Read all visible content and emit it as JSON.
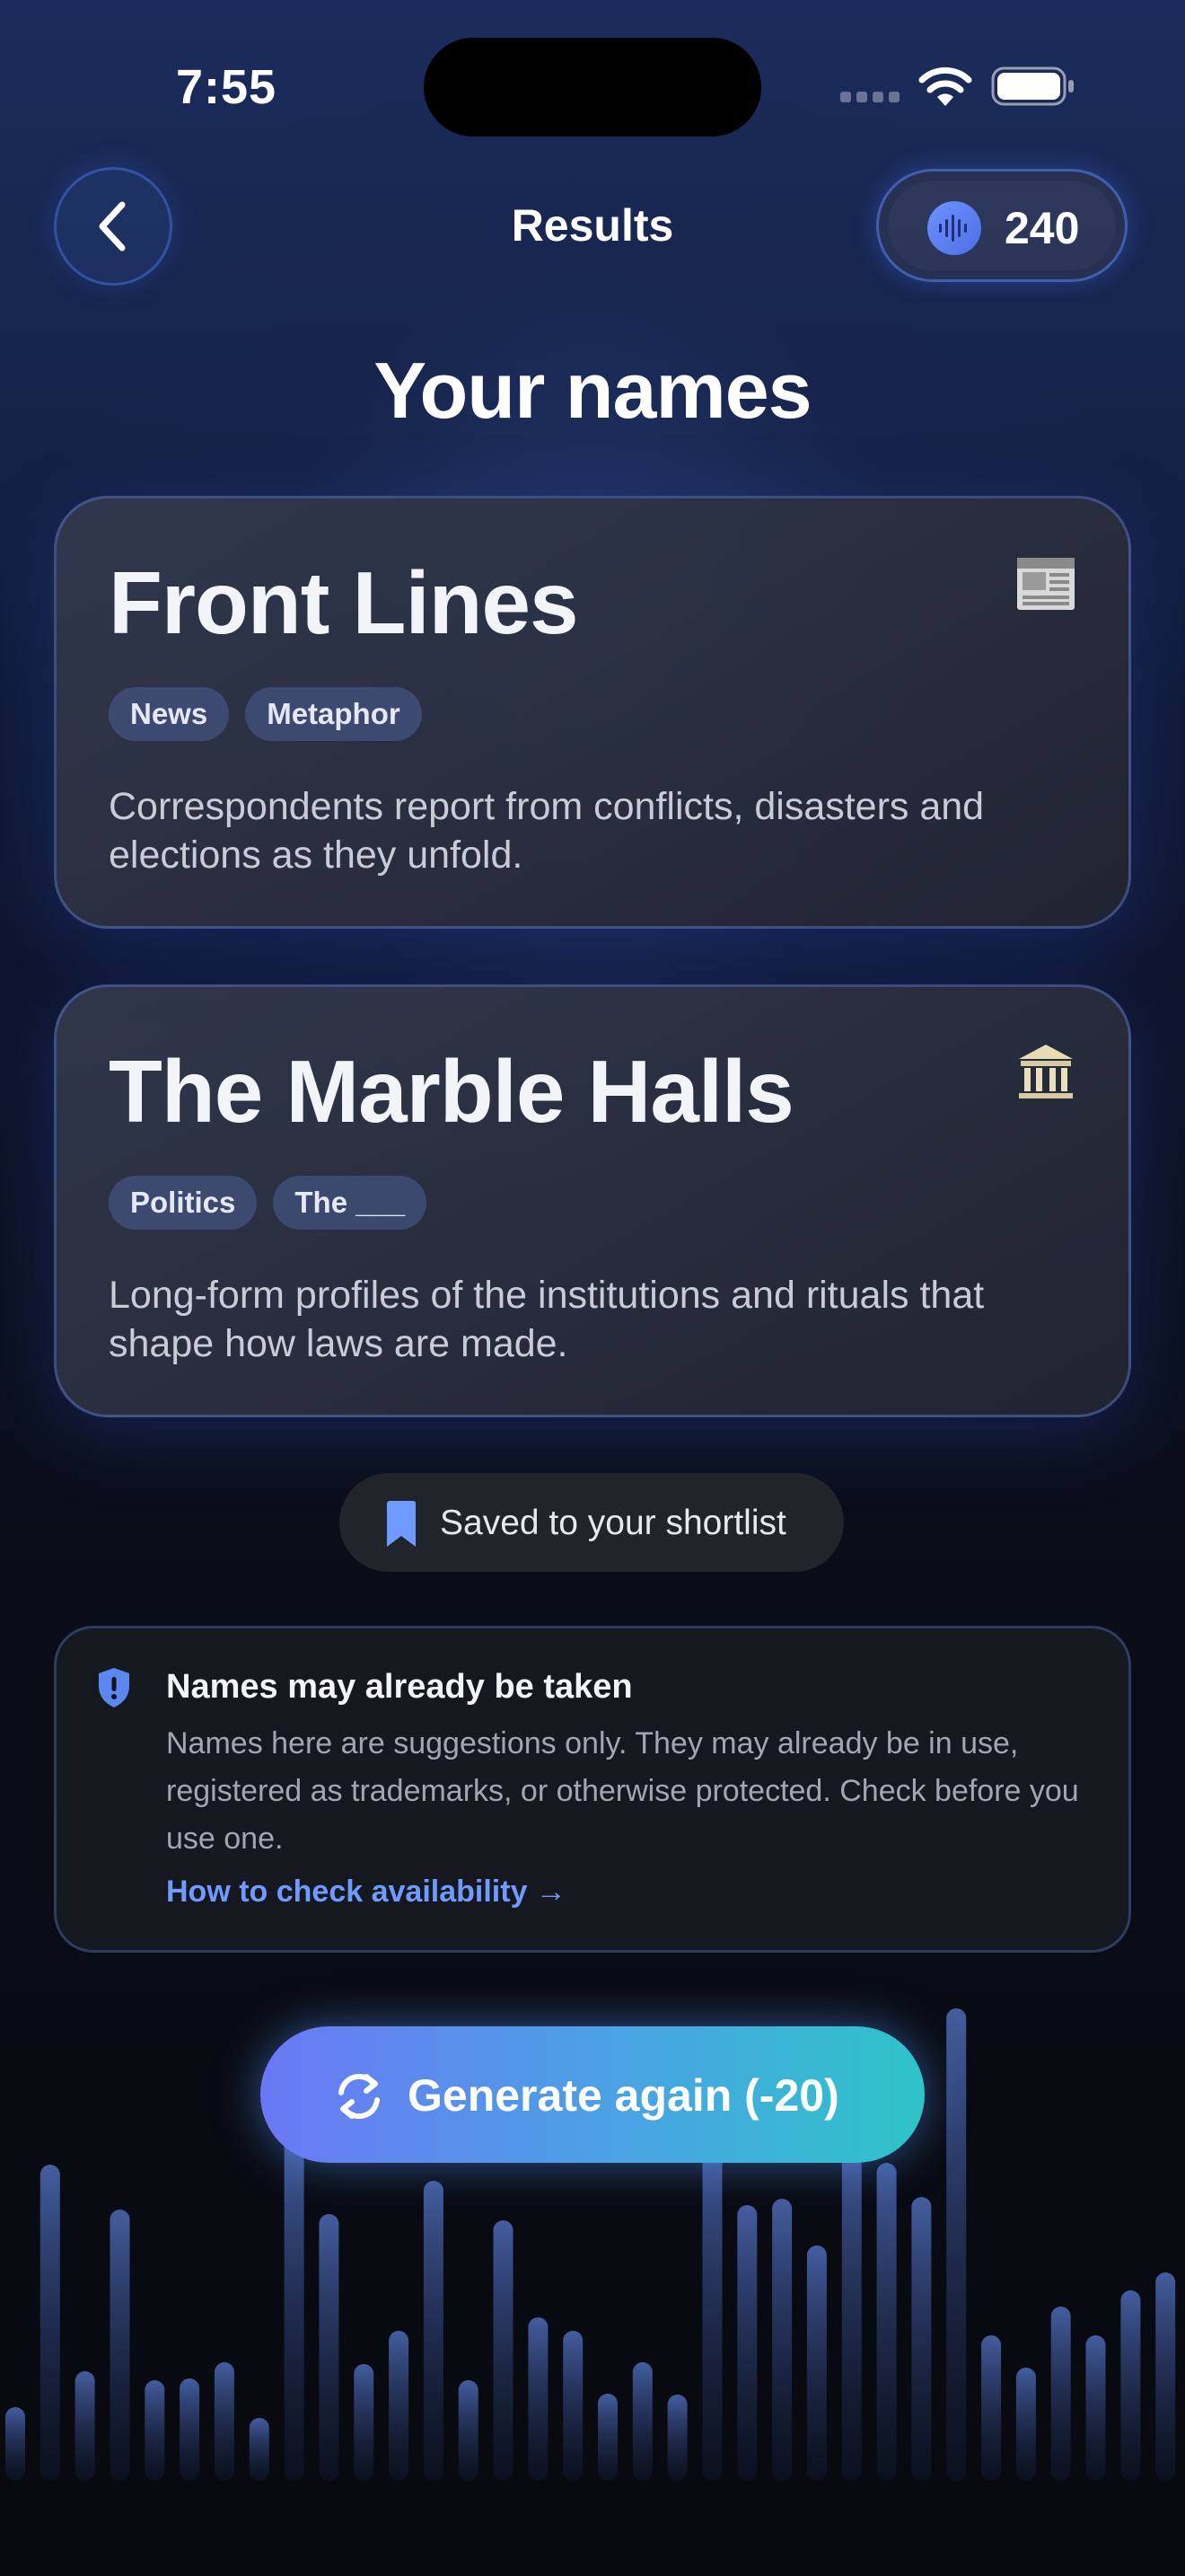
{
  "status_bar": {
    "time": "7:55"
  },
  "nav": {
    "title": "Results",
    "credits": "240"
  },
  "page": {
    "title": "Your names"
  },
  "cards": [
    {
      "title": "Front Lines",
      "emoji": "newspaper-icon",
      "tags": [
        "News",
        "Metaphor"
      ],
      "description": "Correspondents report from conflicts, disasters and elections as they unfold."
    },
    {
      "title": "The Marble Halls",
      "emoji": "classical-building-icon",
      "tags": [
        "Politics",
        "The ___"
      ],
      "description": "Long-form profiles of the institutions and rituals that shape how laws are made."
    }
  ],
  "toast": {
    "text": "Saved to your shortlist"
  },
  "warning": {
    "title": "Names may already be taken",
    "body": "Names here are suggestions only. They may already be in use, registered as trademarks, or otherwise protected. Check before you use one.",
    "link": "How to check availability →"
  },
  "generate": {
    "label": "Generate again (-20)"
  },
  "colors": {
    "accent": "#6f9aff",
    "button_gradient_start": "#6a78f5",
    "button_gradient_end": "#2ec4c8",
    "card_border": "#526ebe"
  }
}
